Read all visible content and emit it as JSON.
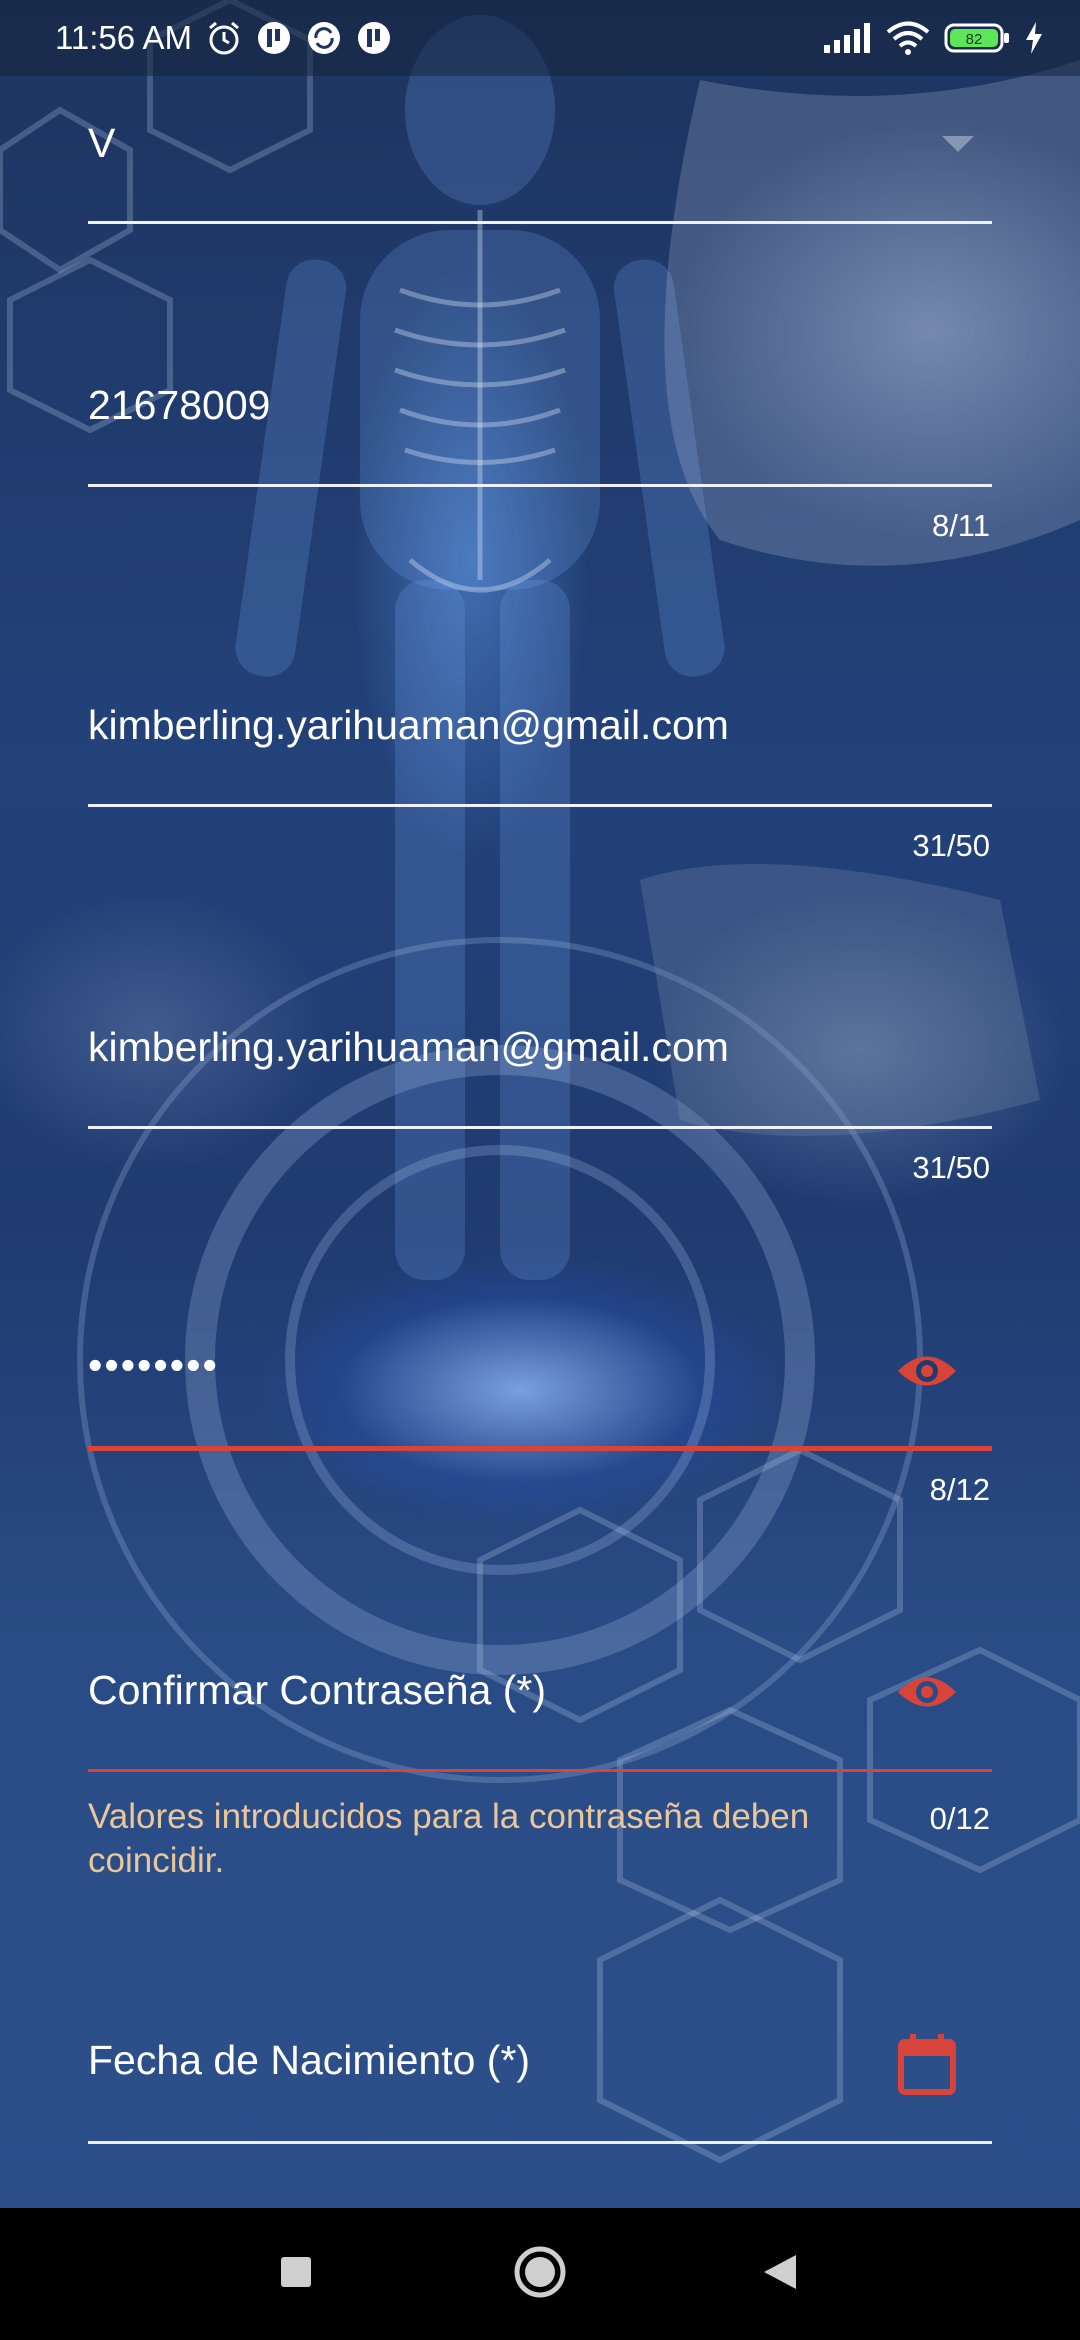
{
  "status_bar": {
    "time": "11:56 AM",
    "battery": "82",
    "icons": [
      "alarm-icon",
      "notification-icon",
      "sync-icon",
      "notification-icon",
      "signal-icon",
      "wifi-icon",
      "battery-icon",
      "charging-icon"
    ]
  },
  "form": {
    "document_type": {
      "value": "V"
    },
    "cedula": {
      "value": "21678009",
      "counter": "8/11"
    },
    "email": {
      "value": "kimberling.yarihuaman@gmail.com",
      "counter": "31/50"
    },
    "confirm_email": {
      "value": "kimberling.yarihuaman@gmail.com",
      "counter": "31/50"
    },
    "password": {
      "value": "••••••••",
      "counter": "8/12",
      "icon": "eye-icon"
    },
    "confirm_password": {
      "label": "Confirmar Contraseña (*)",
      "counter": "0/12",
      "error": "Valores introducidos para la contraseña deben coincidir.",
      "icon": "eye-icon"
    },
    "birth_date": {
      "label": "Fecha de Nacimiento (*)",
      "icon": "calendar-icon"
    }
  },
  "colors": {
    "accent": "#d9443a",
    "error_text": "#e9c79a",
    "underline": "#eef2f8"
  },
  "nav_bar": {
    "icons": [
      "recents-square-icon",
      "home-circle-icon",
      "back-triangle-icon"
    ]
  }
}
